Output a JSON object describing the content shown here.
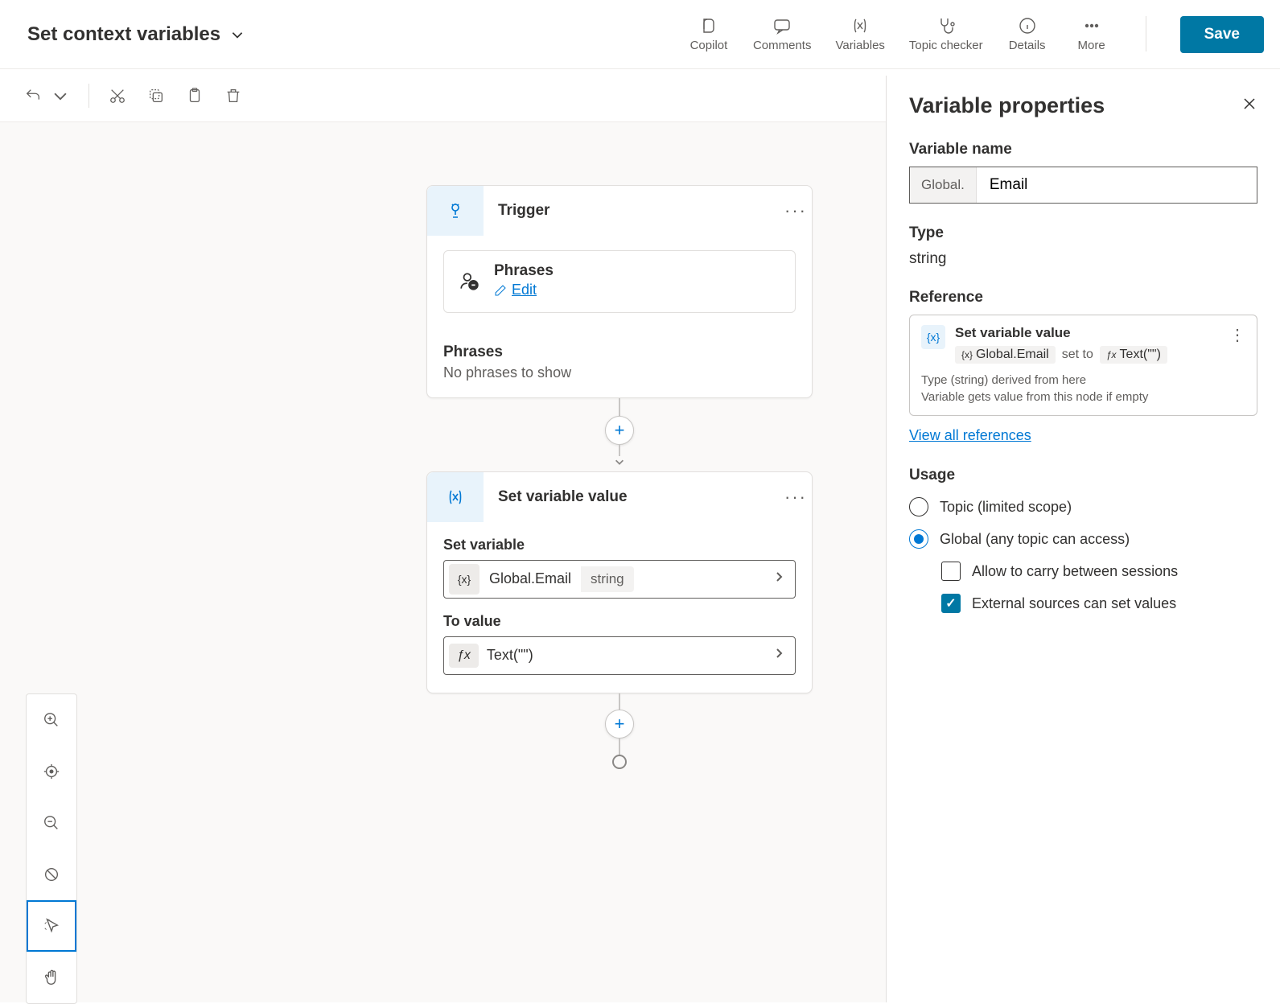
{
  "header": {
    "title": "Set context variables",
    "actions": {
      "copilot": "Copilot",
      "comments": "Comments",
      "variables": "Variables",
      "topic_checker": "Topic checker",
      "details": "Details",
      "more": "More"
    },
    "save": "Save"
  },
  "flow": {
    "trigger": {
      "title": "Trigger",
      "phrases_label": "Phrases",
      "edit": "Edit",
      "phrases_section": "Phrases",
      "no_phrases": "No phrases to show"
    },
    "set_var": {
      "title": "Set variable value",
      "set_variable_label": "Set variable",
      "var_name": "Global.Email",
      "var_type": "string",
      "to_value_label": "To value",
      "to_value_expr": "Text(\"\")"
    }
  },
  "panel": {
    "title": "Variable properties",
    "var_name_label": "Variable name",
    "var_prefix": "Global.",
    "var_name_value": "Email",
    "type_label": "Type",
    "type_value": "string",
    "reference_label": "Reference",
    "ref": {
      "title": "Set variable value",
      "chip_var": "Global.Email",
      "set_to": "set to",
      "chip_expr": "Text(\"\")",
      "footer1": "Type (string) derived from here",
      "footer2": "Variable gets value from this node if empty"
    },
    "view_all": "View all references",
    "usage_label": "Usage",
    "usage_topic": "Topic (limited scope)",
    "usage_global": "Global (any topic can access)",
    "check_carry": "Allow to carry between sessions",
    "check_external": "External sources can set values"
  }
}
